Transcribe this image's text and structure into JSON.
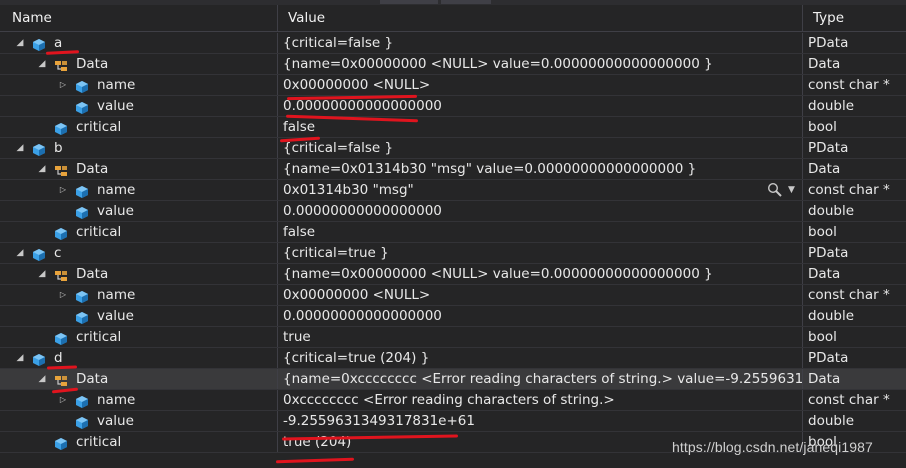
{
  "columns": {
    "name": "Name",
    "value": "Value",
    "type": "Type"
  },
  "rows": [
    {
      "name": "a",
      "value": "{critical=false }",
      "type": "PData",
      "depth": 0,
      "expander": "open",
      "icon": "object"
    },
    {
      "name": "Data",
      "value": "{name=0x00000000 <NULL> value=0.00000000000000000 }",
      "type": "Data",
      "depth": 1,
      "expander": "open",
      "icon": "base-class"
    },
    {
      "name": "name",
      "value": "0x00000000 <NULL>",
      "type": "const char *",
      "depth": 2,
      "expander": "closed",
      "icon": "field"
    },
    {
      "name": "value",
      "value": "0.00000000000000000",
      "type": "double",
      "depth": 2,
      "expander": "none",
      "icon": "field"
    },
    {
      "name": "critical",
      "value": "false",
      "type": "bool",
      "depth": 1,
      "expander": "none",
      "icon": "field"
    },
    {
      "name": "b",
      "value": "{critical=false }",
      "type": "PData",
      "depth": 0,
      "expander": "open",
      "icon": "object"
    },
    {
      "name": "Data",
      "value": "{name=0x01314b30 \"msg\" value=0.00000000000000000 }",
      "type": "Data",
      "depth": 1,
      "expander": "open",
      "icon": "base-class"
    },
    {
      "name": "name",
      "value": "0x01314b30 \"msg\"",
      "type": "const char *",
      "depth": 2,
      "expander": "closed",
      "icon": "field",
      "visualizer": true
    },
    {
      "name": "value",
      "value": "0.00000000000000000",
      "type": "double",
      "depth": 2,
      "expander": "none",
      "icon": "field"
    },
    {
      "name": "critical",
      "value": "false",
      "type": "bool",
      "depth": 1,
      "expander": "none",
      "icon": "field"
    },
    {
      "name": "c",
      "value": "{critical=true }",
      "type": "PData",
      "depth": 0,
      "expander": "open",
      "icon": "object"
    },
    {
      "name": "Data",
      "value": "{name=0x00000000 <NULL> value=0.00000000000000000 }",
      "type": "Data",
      "depth": 1,
      "expander": "open",
      "icon": "base-class"
    },
    {
      "name": "name",
      "value": "0x00000000 <NULL>",
      "type": "const char *",
      "depth": 2,
      "expander": "closed",
      "icon": "field"
    },
    {
      "name": "value",
      "value": "0.00000000000000000",
      "type": "double",
      "depth": 2,
      "expander": "none",
      "icon": "field"
    },
    {
      "name": "critical",
      "value": "true",
      "type": "bool",
      "depth": 1,
      "expander": "none",
      "icon": "field"
    },
    {
      "name": "d",
      "value": "{critical=true (204) }",
      "type": "PData",
      "depth": 0,
      "expander": "open",
      "icon": "object"
    },
    {
      "name": "Data",
      "value": "{name=0xcccccccc <Error reading characters of string.> value=-9.255963134...",
      "type": "Data",
      "depth": 1,
      "expander": "open",
      "icon": "base-class",
      "selected": true
    },
    {
      "name": "name",
      "value": "0xcccccccc <Error reading characters of string.>",
      "type": "const char *",
      "depth": 2,
      "expander": "closed",
      "icon": "field"
    },
    {
      "name": "value",
      "value": "-9.2559631349317831e+61",
      "type": "double",
      "depth": 2,
      "expander": "none",
      "icon": "field"
    },
    {
      "name": "critical",
      "value": "true (204)",
      "type": "bool",
      "depth": 1,
      "expander": "none",
      "icon": "field"
    }
  ],
  "watermark": "https://blog.csdn.net/janeqi1987",
  "colors": {
    "background": "#252526",
    "grid": "#3f3f46",
    "selected_row": "#3a3a3c",
    "icon_blue": "#3ba0e6",
    "icon_orange": "#e8a33c",
    "annotation_red": "#e0141e"
  }
}
